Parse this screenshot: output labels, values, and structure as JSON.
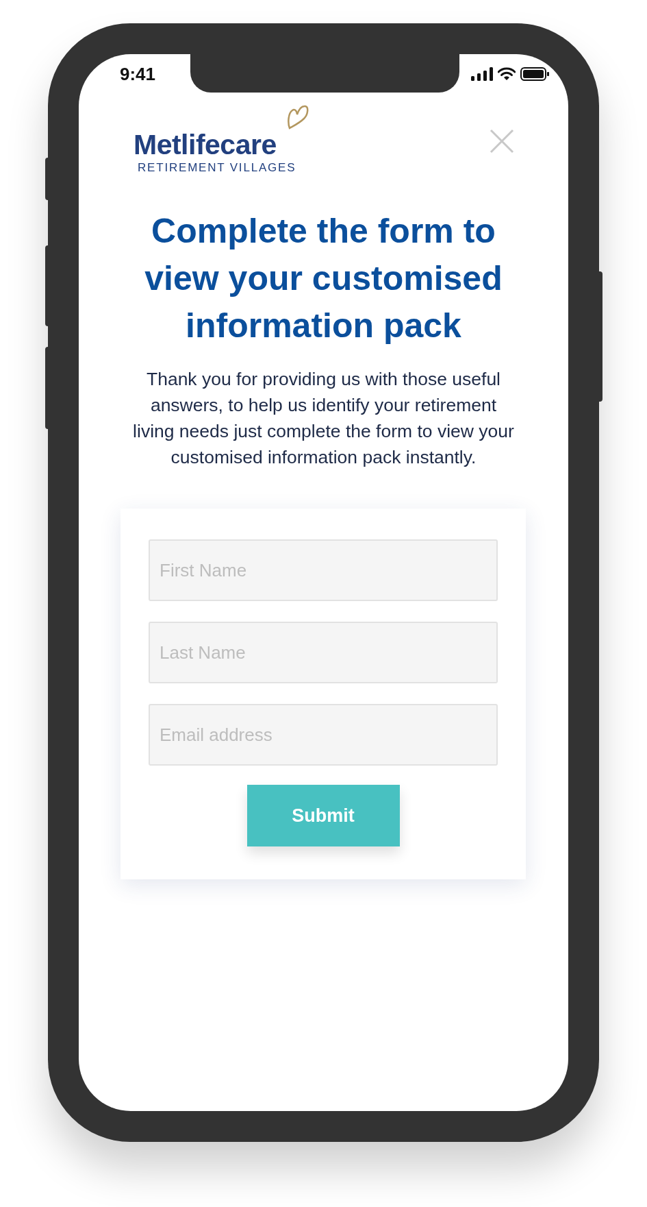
{
  "status_bar": {
    "time": "9:41"
  },
  "logo": {
    "name": "Metlifecare",
    "tagline": "RETIREMENT VILLAGES"
  },
  "heading": "Complete the form to view your customised information pack",
  "intro": "Thank you for providing us with those useful answers, to help us identify your retirement living needs just complete the form to view your customised information pack instantly.",
  "form": {
    "fields": [
      {
        "placeholder": "First Name"
      },
      {
        "placeholder": "Last Name"
      },
      {
        "placeholder": "Email address"
      }
    ],
    "submit": "Submit"
  }
}
